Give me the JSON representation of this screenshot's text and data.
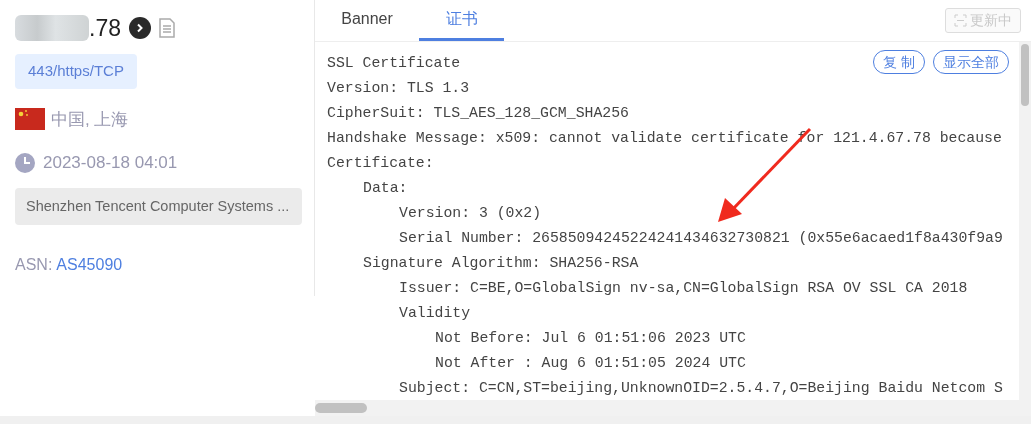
{
  "host": {
    "ip_suffix": ".78",
    "ip_blurred": true
  },
  "port_tag": "443/https/TCP",
  "location": "中国, 上海",
  "time": "2023-08-18 04:01",
  "org": "Shenzhen Tencent Computer Systems ...",
  "asn": {
    "label": "ASN:",
    "value": "AS45090"
  },
  "tabs": [
    {
      "label": "Banner",
      "selected": false
    },
    {
      "label": "证书",
      "selected": true
    }
  ],
  "update_button": {
    "label": "更新中",
    "disabled": true
  },
  "actions": [
    "复 制",
    "显示全部"
  ],
  "cert_lines": [
    {
      "text": "SSL Certificate"
    },
    {
      "text": "Version: TLS 1.3"
    },
    {
      "text": "CipherSuit: TLS_AES_128_GCM_SHA256"
    },
    {
      "text": "Handshake Message: x509: cannot validate certificate for 121.4.67.78 because"
    },
    {
      "text": "Certificate:",
      "children": [
        {
          "text": "Data:",
          "children": [
            {
              "text": "Version: 3 (0x2)"
            },
            {
              "text": "Serial Number: 26585094245224241434632730821 (0x55e6acaed1f8a430f9a9"
            }
          ]
        },
        {
          "text": "Signature Algorithm: SHA256-RSA",
          "children": [
            {
              "text": "Issuer: C=BE,O=GlobalSign nv-sa,CN=GlobalSign RSA OV SSL CA 2018"
            },
            {
              "text": "Validity",
              "children": [
                {
                  "text": "Not Before: Jul 6 01:51:06 2023 UTC"
                },
                {
                  "text": "Not After : Aug 6 01:51:05 2024 UTC"
                }
              ]
            },
            {
              "text": "Subject: C=CN,ST=beijing,UnknownOID=2.5.4.7,O=Beijing Baidu Netcom S"
            }
          ]
        }
      ]
    }
  ]
}
